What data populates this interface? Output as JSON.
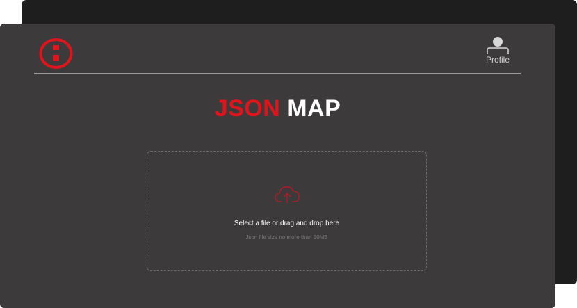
{
  "header": {
    "logo_icon": "logo-icon",
    "profile": {
      "icon": "user-icon",
      "label": "Profile"
    }
  },
  "title": {
    "accent": "JSON",
    "main": "MAP"
  },
  "upload": {
    "icon": "cloud-upload-icon",
    "prompt": "Select a file or drag and drop here",
    "hint": "Json file size no more than 10MB"
  },
  "colors": {
    "accent": "#e1141c",
    "background": "#3c3a3b",
    "back_window": "#1f1e1f",
    "text": "#ffffff",
    "muted_text": "#7b797a"
  }
}
